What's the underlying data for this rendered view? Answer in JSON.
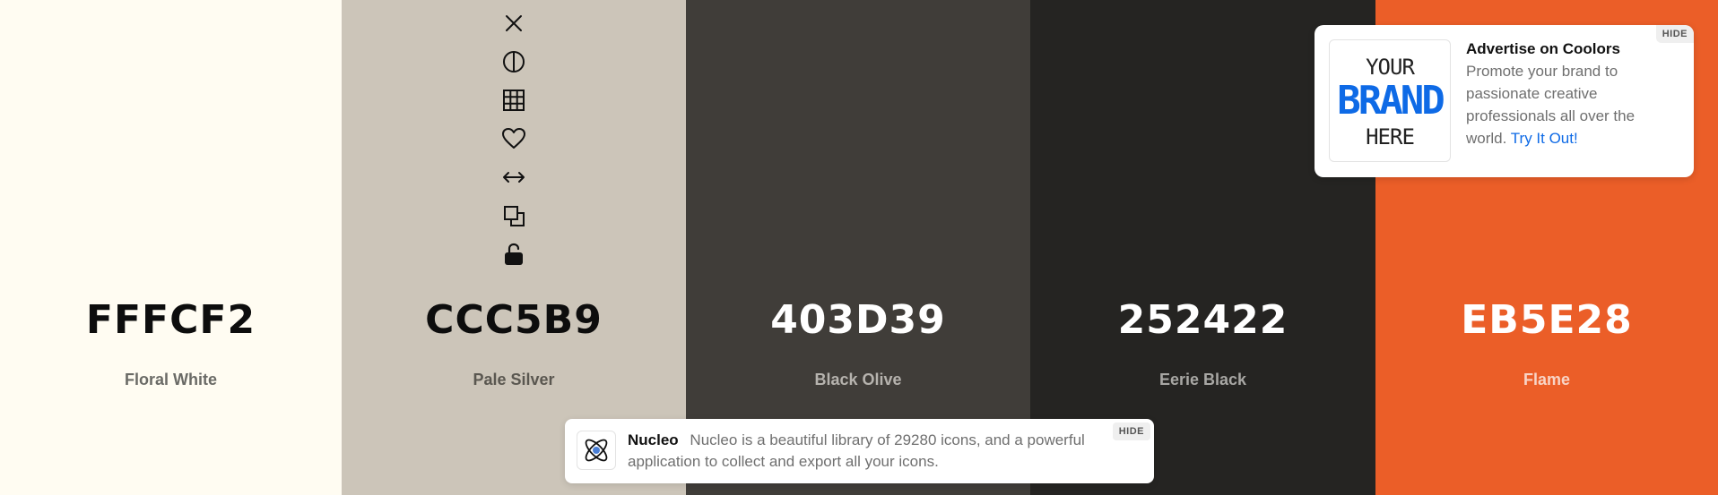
{
  "palette": [
    {
      "hex": "FFFCF2",
      "name": "Floral White",
      "bg": "#FFFCF2",
      "hex_color": "#0d0d0d",
      "name_color": "#6a6a66"
    },
    {
      "hex": "CCC5B9",
      "name": "Pale Silver",
      "bg": "#CCC5B9",
      "hex_color": "#0d0d0d",
      "name_color": "#5a5750"
    },
    {
      "hex": "403D39",
      "name": "Black Olive",
      "bg": "#403D39",
      "hex_color": "#ffffff",
      "name_color": "#b6b3ae"
    },
    {
      "hex": "252422",
      "name": "Eerie Black",
      "bg": "#252422",
      "hex_color": "#ffffff",
      "name_color": "#a8a7a4"
    },
    {
      "hex": "EB5E28",
      "name": "Flame",
      "bg": "#EB5E28",
      "hex_color": "#ffffff",
      "name_color": "#f8d4c6"
    }
  ],
  "color_tools": [
    {
      "icon": "close-icon",
      "name": "remove-color-button"
    },
    {
      "icon": "shades-icon",
      "name": "view-shades-button"
    },
    {
      "icon": "grid-icon",
      "name": "view-grid-button"
    },
    {
      "icon": "heart-icon",
      "name": "save-color-button"
    },
    {
      "icon": "drag-arrows-icon",
      "name": "drag-color-button"
    },
    {
      "icon": "copy-icon",
      "name": "copy-hex-button"
    },
    {
      "icon": "unlock-icon",
      "name": "toggle-lock-button"
    }
  ],
  "ad": {
    "thumb_lines": [
      "YOUR",
      "BRAND",
      "HERE"
    ],
    "title": "Advertise on Coolors",
    "body": "Promote your brand to passionate creative professionals all over the world.",
    "link": "Try It Out!",
    "hide_label": "HIDE",
    "link_color": "#0e6ae6"
  },
  "notice": {
    "title": "Nucleo",
    "body": "Nucleo is a beautiful library of 29280 icons, and a powerful application to collect and export all your icons.",
    "hide_label": "HIDE",
    "icon": "atom-icon"
  }
}
